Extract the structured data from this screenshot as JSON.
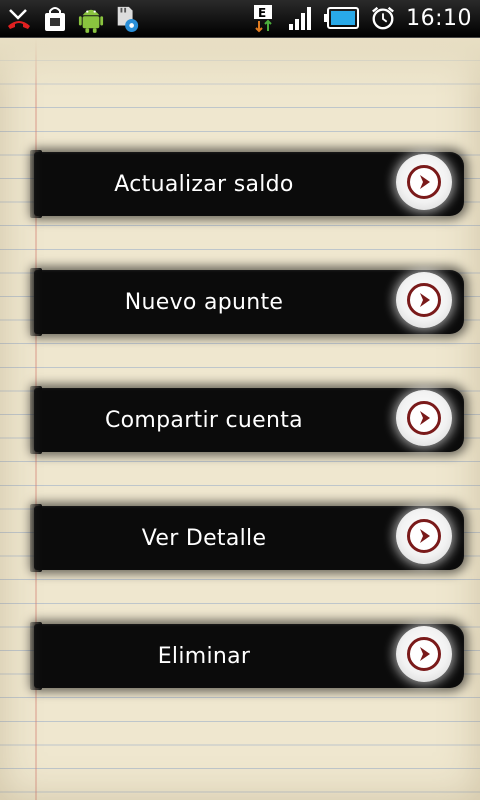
{
  "status_bar": {
    "time": "16:10",
    "icons_left": [
      "missed-call-icon",
      "shopping-bag-icon",
      "android-icon",
      "sd-card-settings-icon"
    ],
    "icons_right": [
      "edge-data-icon",
      "signal-icon",
      "battery-icon",
      "alarm-icon"
    ]
  },
  "menu": {
    "items": [
      {
        "label": "Actualizar saldo"
      },
      {
        "label": "Nuevo apunte"
      },
      {
        "label": "Compartir cuenta"
      },
      {
        "label": "Ver Detalle"
      },
      {
        "label": "Eliminar"
      }
    ]
  },
  "colors": {
    "paper": "#efe7cf",
    "bar": "#0b0b0b",
    "arrow": "#7a1a1a"
  }
}
